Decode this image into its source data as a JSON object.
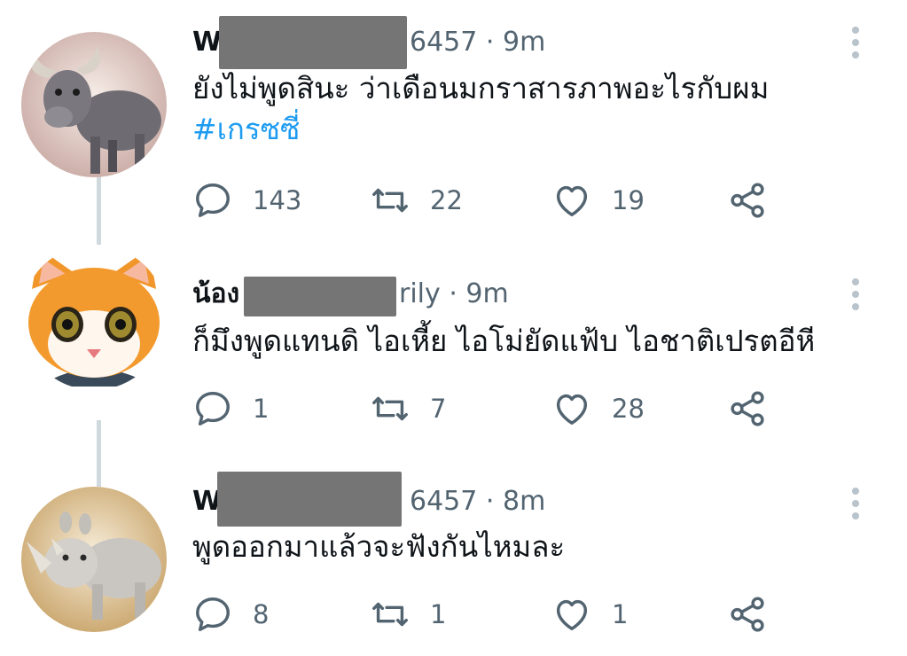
{
  "colors": {
    "text": "#0f1419",
    "secondary": "#536471",
    "link": "#1d9bf0",
    "thread_line": "#cfd9de",
    "redaction": "#757575"
  },
  "tweets": [
    {
      "name_visible_prefix": "W",
      "handle_visible_suffix": "6457",
      "separator": "·",
      "time": "9m",
      "text": "ยังไม่พูดสินะ ว่าเดือนมกราสารภาพอะไรกับผม",
      "hashtag": "#เกรซซี่",
      "avatar": "water-buffalo-avatar",
      "replies": "143",
      "retweets": "22",
      "likes": "19"
    },
    {
      "name_visible_prefix": "น้อง",
      "handle_visible_suffix": "rily",
      "separator": "·",
      "time": "9m",
      "text": "ก็มึงพูดแทนดิ ไอเหี้ย ไอโม่ยัดแฟ้บ ไอชาติเปรตอีหี",
      "avatar": "orange-cat-avatar",
      "replies": "1",
      "retweets": "7",
      "likes": "28"
    },
    {
      "name_visible_prefix": "W",
      "handle_visible_suffix": "6457",
      "separator": "·",
      "time": "8m",
      "text": "พูดออกมาแล้วจะฟังกันไหมละ",
      "avatar": "rhino-avatar",
      "replies": "8",
      "retweets": "1",
      "likes": "1"
    }
  ],
  "icons": {
    "reply": "reply-icon",
    "retweet": "retweet-icon",
    "like": "heart-icon",
    "share": "share-icon",
    "more": "more-vertical-icon"
  }
}
